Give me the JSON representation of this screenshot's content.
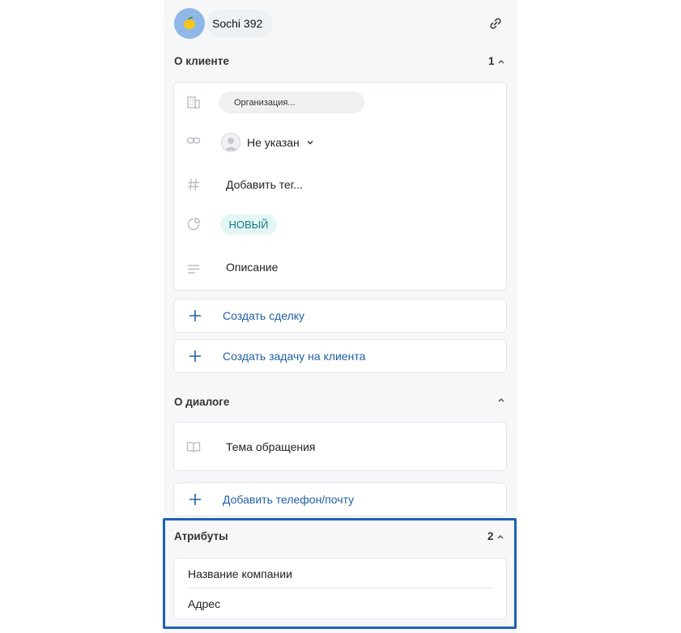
{
  "header": {
    "client_name": "Sochi 392",
    "avatar_icon": "lemon-icon",
    "link_icon": "link-icon"
  },
  "client_section": {
    "title": "О клиенте",
    "count": "1",
    "organization_placeholder": "Организация...",
    "responsible": "Не указан",
    "add_tag": "Добавить тег...",
    "status_badge": "НОВЫЙ",
    "description": "Описание"
  },
  "actions": {
    "create_deal": "Создать сделку",
    "create_task": "Создать задачу на клиента"
  },
  "dialog_section": {
    "title": "О диалоге",
    "topic": "Тема обращения",
    "add_contact": "Добавить телефон/почту"
  },
  "attributes_section": {
    "title": "Атрибуты",
    "count": "2",
    "items": [
      "Название компании",
      "Адрес"
    ]
  },
  "colors": {
    "accent_link": "#1f5fa8",
    "badge_bg": "#e3f6f6",
    "badge_text": "#17797f",
    "highlight_border": "#1f5fb5"
  }
}
